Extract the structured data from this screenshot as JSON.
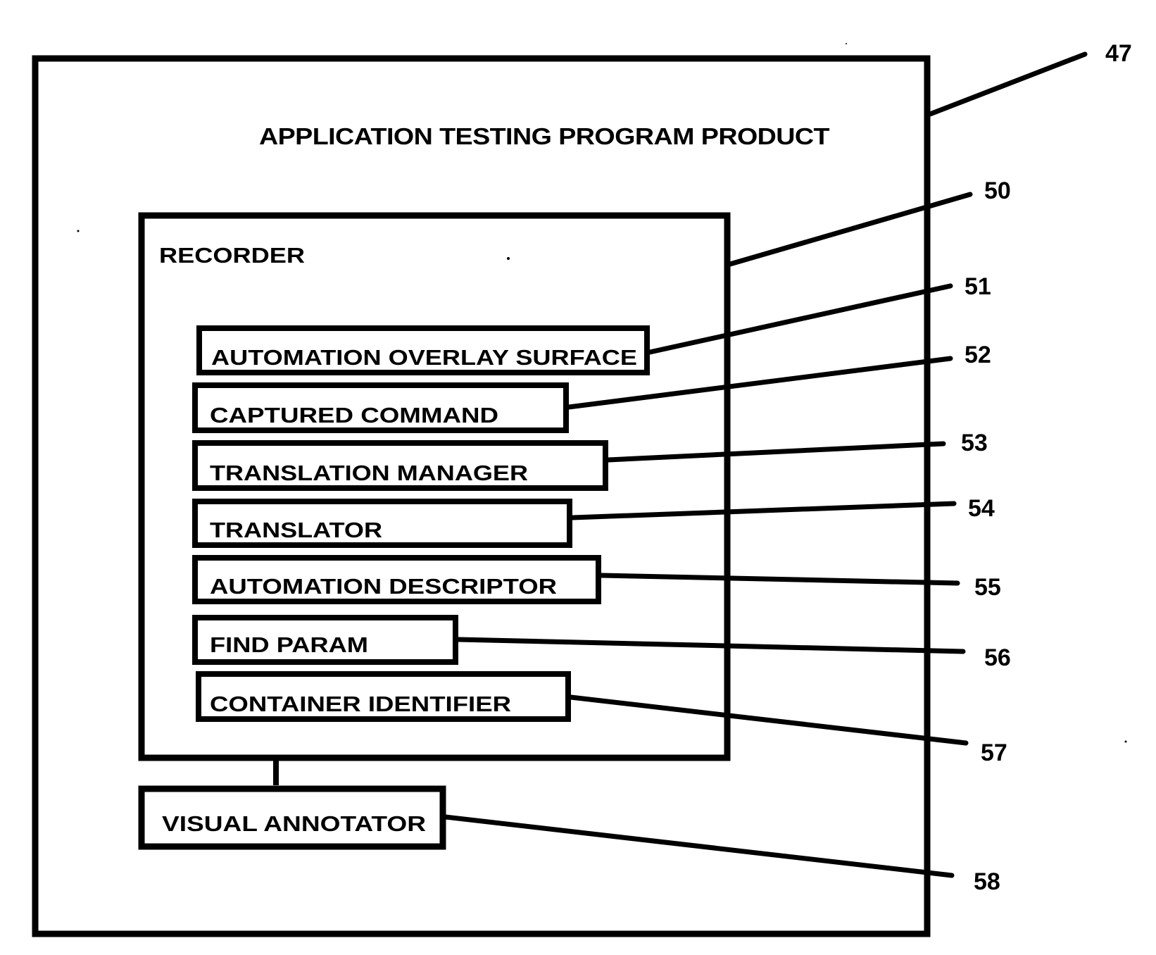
{
  "diagram": {
    "outer": {
      "title": "APPLICATION TESTING PROGRAM PRODUCT",
      "ref": "47"
    },
    "recorder": {
      "title": "RECORDER",
      "ref": "50"
    },
    "components": [
      {
        "label": "AUTOMATION OVERLAY SURFACE",
        "ref": "51"
      },
      {
        "label": "CAPTURED COMMAND",
        "ref": "52"
      },
      {
        "label": "TRANSLATION MANAGER",
        "ref": "53"
      },
      {
        "label": "TRANSLATOR",
        "ref": "54"
      },
      {
        "label": "AUTOMATION DESCRIPTOR",
        "ref": "55"
      },
      {
        "label": "FIND PARAM",
        "ref": "56"
      },
      {
        "label": "CONTAINER IDENTIFIER",
        "ref": "57"
      }
    ],
    "annotator": {
      "label": "VISUAL ANNOTATOR",
      "ref": "58"
    }
  }
}
